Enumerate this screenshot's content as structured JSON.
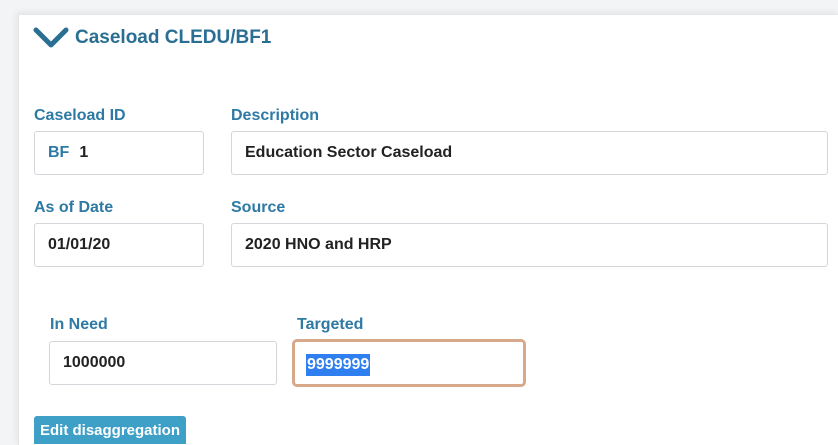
{
  "header": {
    "title": "Caseload CLEDU/BF1",
    "icon": "chevron-down-icon"
  },
  "caseload_id": {
    "label": "Caseload ID",
    "prefix": "BF",
    "value": "1"
  },
  "description": {
    "label": "Description",
    "value": "Education Sector Caseload"
  },
  "as_of_date": {
    "label": "As of Date",
    "value": "01/01/20"
  },
  "source": {
    "label": "Source",
    "value": "2020 HNO and HRP"
  },
  "in_need": {
    "label": "In Need",
    "value": "1000000"
  },
  "targeted": {
    "label": "Targeted",
    "value": "9999999"
  },
  "edit_button": {
    "label": "Edit disaggregation"
  },
  "colors": {
    "accent": "#2e7aa4",
    "button": "#3fa0c7",
    "focus": "#d8a88a",
    "selection": "#2f7ff0"
  }
}
